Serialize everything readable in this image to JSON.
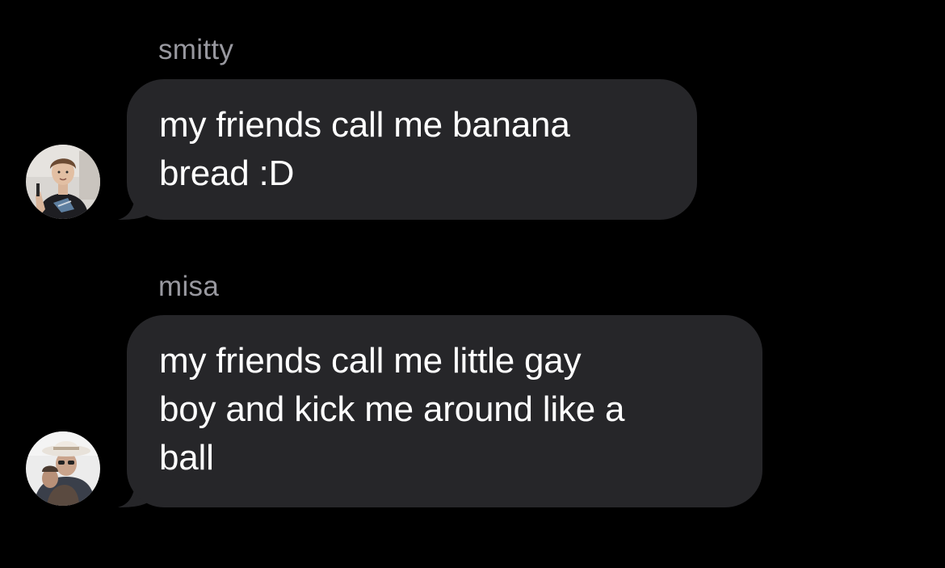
{
  "messages": [
    {
      "sender": "smitty",
      "text": "my friends call me banana\nbread :D",
      "avatar_icon": "profile-photo-smitty"
    },
    {
      "sender": "misa",
      "text": "my friends call me little gay\nboy and kick me around like a\nball",
      "avatar_icon": "profile-photo-misa"
    }
  ],
  "colors": {
    "background": "#000000",
    "bubble": "#262629",
    "message_text": "#ffffff",
    "sender_name": "#98989f"
  }
}
